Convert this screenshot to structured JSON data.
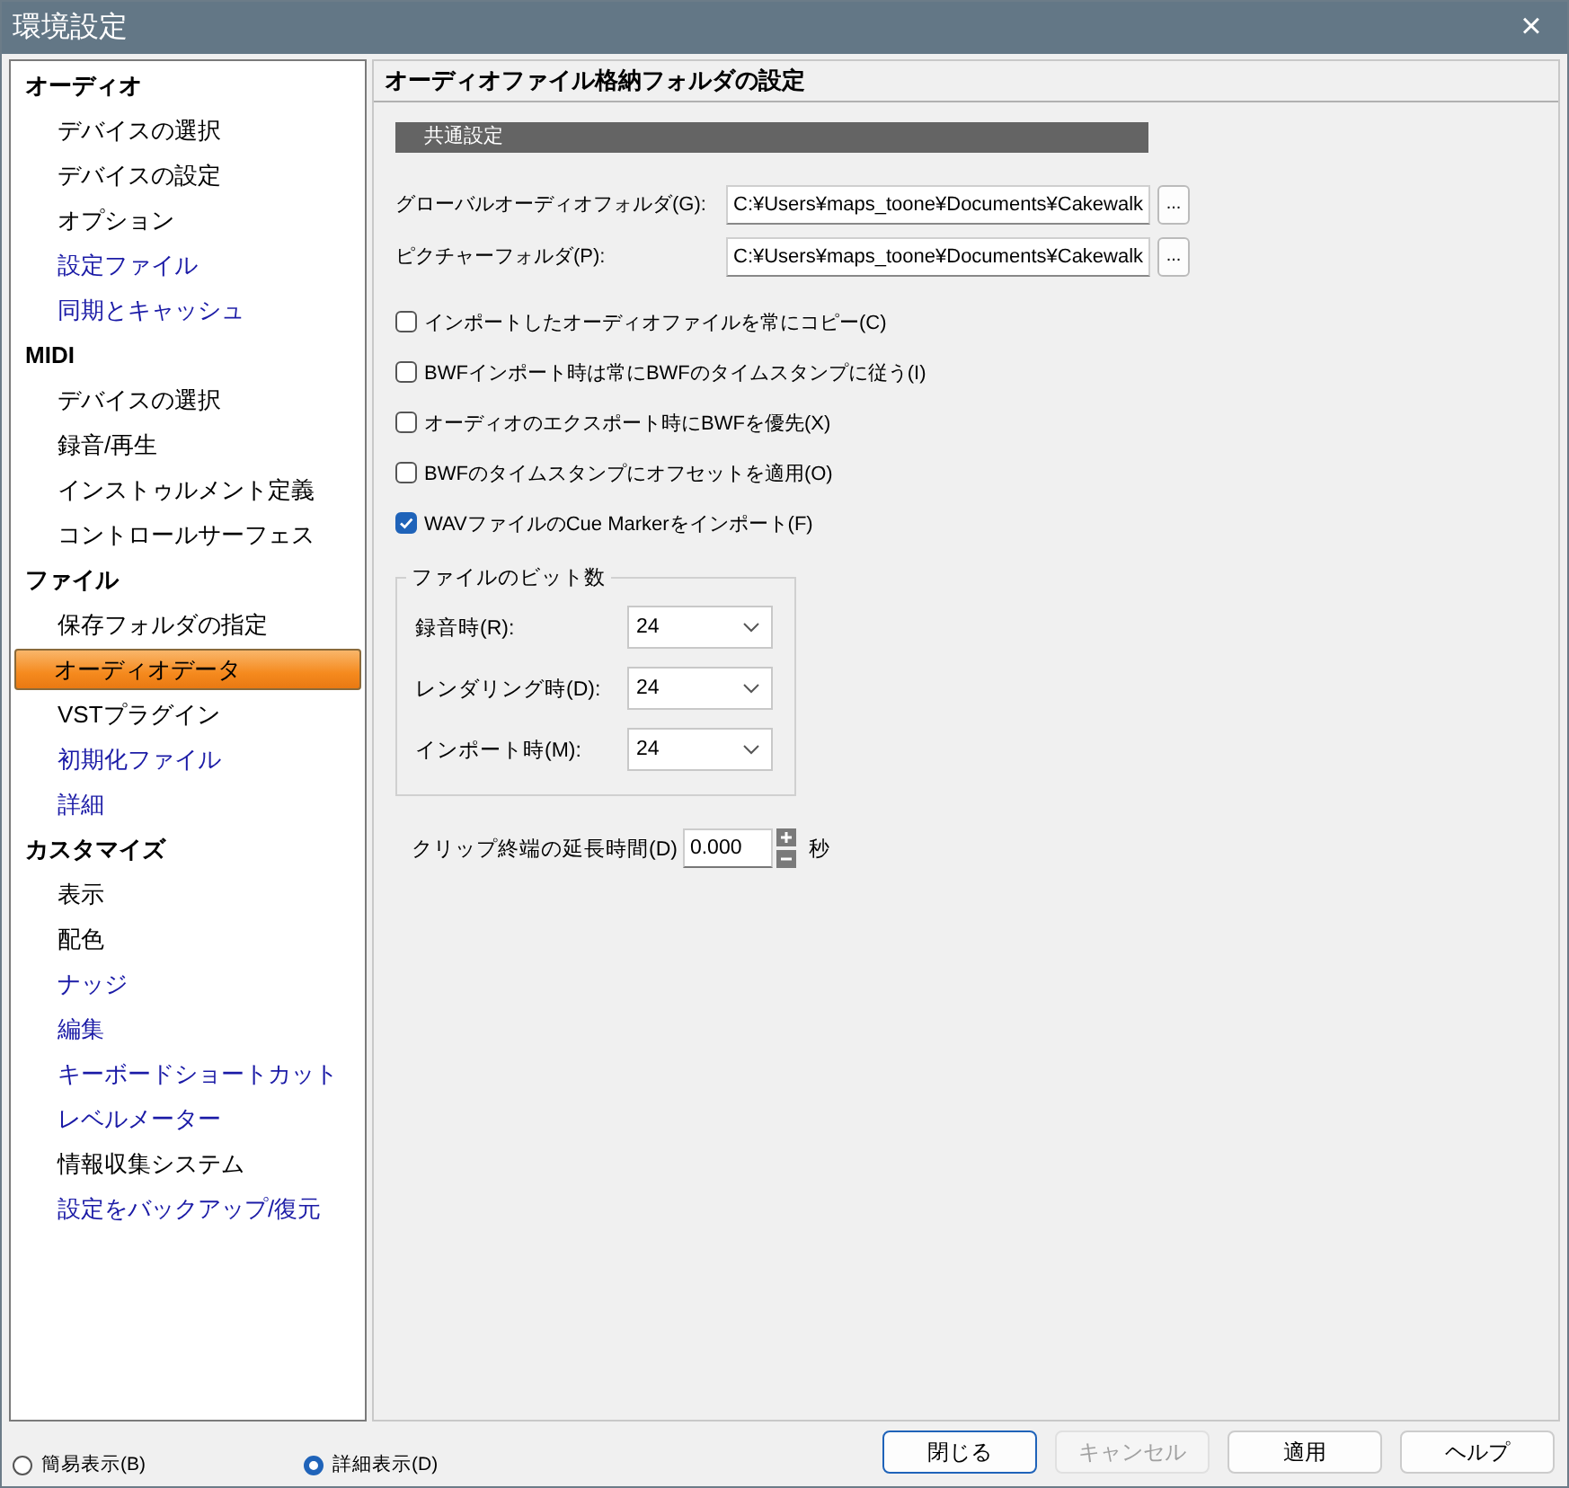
{
  "window": {
    "title": "環境設定",
    "close": "×"
  },
  "sidebar": {
    "groups": [
      {
        "label": "オーディオ",
        "items": [
          {
            "label": "デバイスの選択",
            "selected": false,
            "linked": false
          },
          {
            "label": "デバイスの設定",
            "selected": false,
            "linked": false
          },
          {
            "label": "オプション",
            "selected": false,
            "linked": false
          },
          {
            "label": "設定ファイル",
            "selected": false,
            "linked": true
          },
          {
            "label": "同期とキャッシュ",
            "selected": false,
            "linked": true
          }
        ]
      },
      {
        "label": "MIDI",
        "items": [
          {
            "label": "デバイスの選択",
            "selected": false,
            "linked": false
          },
          {
            "label": "録音/再生",
            "selected": false,
            "linked": false
          },
          {
            "label": "インストゥルメント定義",
            "selected": false,
            "linked": false
          },
          {
            "label": "コントロールサーフェス",
            "selected": false,
            "linked": false
          }
        ]
      },
      {
        "label": "ファイル",
        "items": [
          {
            "label": "保存フォルダの指定",
            "selected": false,
            "linked": false
          },
          {
            "label": "オーディオデータ",
            "selected": true,
            "linked": false
          },
          {
            "label": "VSTプラグイン",
            "selected": false,
            "linked": false
          },
          {
            "label": "初期化ファイル",
            "selected": false,
            "linked": true
          },
          {
            "label": "詳細",
            "selected": false,
            "linked": true
          }
        ]
      },
      {
        "label": "カスタマイズ",
        "items": [
          {
            "label": "表示",
            "selected": false,
            "linked": false
          },
          {
            "label": "配色",
            "selected": false,
            "linked": false
          },
          {
            "label": "ナッジ",
            "selected": false,
            "linked": true
          },
          {
            "label": "編集",
            "selected": false,
            "linked": true
          },
          {
            "label": "キーボードショートカット",
            "selected": false,
            "linked": true
          },
          {
            "label": "レベルメーター",
            "selected": false,
            "linked": true
          },
          {
            "label": "情報収集システム",
            "selected": false,
            "linked": false
          },
          {
            "label": "設定をバックアップ/復元",
            "selected": false,
            "linked": true
          }
        ]
      }
    ]
  },
  "panel": {
    "title": "オーディオファイル格納フォルダの設定",
    "section": "共通設定",
    "folders": [
      {
        "label": "グローバルオーディオフォルダ(G):",
        "value": "C:¥Users¥maps_toone¥Documents¥Cakewalk",
        "browse": "..."
      },
      {
        "label": "ピクチャーフォルダ(P):",
        "value": "C:¥Users¥maps_toone¥Documents¥Cakewalk",
        "browse": "..."
      }
    ],
    "options": [
      {
        "label": "インポートしたオーディオファイルを常にコピー(C)",
        "checked": false
      },
      {
        "label": "BWFインポート時は常にBWFのタイムスタンプに従う(I)",
        "checked": false
      },
      {
        "label": "オーディオのエクスポート時にBWFを優先(X)",
        "checked": false
      },
      {
        "label": "BWFのタイムスタンプにオフセットを適用(O)",
        "checked": false
      },
      {
        "label": "WAVファイルのCue Markerをインポート(F)",
        "checked": true
      }
    ],
    "bit_depth": {
      "title": "ファイルのビット数",
      "rows": [
        {
          "label": "録音時(R):",
          "value": "24"
        },
        {
          "label": "レンダリング時(D):",
          "value": "24"
        },
        {
          "label": "インポート時(M):",
          "value": "24"
        }
      ]
    },
    "clip_extension": {
      "label": "クリップ終端の延長時間(D)",
      "value": "0.000",
      "unit": "秒"
    }
  },
  "view_modes": [
    {
      "label": "簡易表示(B)",
      "selected": false
    },
    {
      "label": "詳細表示(D)",
      "selected": true
    }
  ],
  "buttons": [
    {
      "label": "閉じる",
      "disabled": false,
      "default": true
    },
    {
      "label": "キャンセル",
      "disabled": true,
      "default": false
    },
    {
      "label": "適用",
      "disabled": false,
      "default": false
    },
    {
      "label": "ヘルプ",
      "disabled": false,
      "default": false
    }
  ]
}
